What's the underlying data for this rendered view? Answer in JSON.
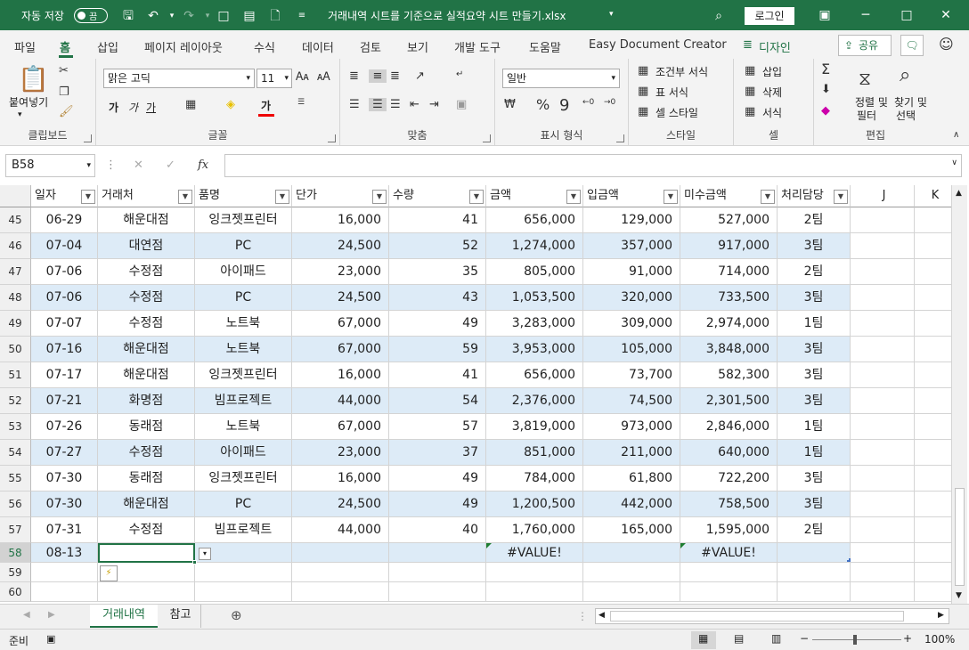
{
  "title": {
    "autosave_label": "자동 저장",
    "toggle_state": "끔",
    "filename": "거래내역 시트를 기준으로 실적요약 시트 만들기.xlsx",
    "login": "로그인"
  },
  "tabs": [
    "파일",
    "홈",
    "삽입",
    "페이지 레이아웃",
    "수식",
    "데이터",
    "검토",
    "보기",
    "개발 도구",
    "도움말",
    "Easy Document Creator",
    "디자인"
  ],
  "share": "공유",
  "ribbon": {
    "clipboard": {
      "paste": "붙여넣기",
      "name": "클립보드"
    },
    "font": {
      "family": "맑은 고딕",
      "size": "11",
      "name": "글꼴",
      "bold": "가",
      "italic": "가",
      "underline": "가",
      "font_color": "가"
    },
    "align": {
      "name": "맞춤"
    },
    "number": {
      "format": "일반",
      "name": "표시 형식"
    },
    "styles": {
      "conditional": "조건부 서식",
      "table": "표 서식",
      "cell": "셀 스타일",
      "name": "스타일"
    },
    "cells": {
      "insert": "삽입",
      "delete": "삭제",
      "format": "서식",
      "name": "셀"
    },
    "editing": {
      "sort": "정렬 및",
      "filter": "필터",
      "find": "찾기 및",
      "select": "선택",
      "name": "편집"
    }
  },
  "formula": {
    "namebox": "B58",
    "fx": "fx",
    "value": ""
  },
  "columns": [
    "일자",
    "거래처",
    "품명",
    "단가",
    "수량",
    "금액",
    "입금액",
    "미수금액",
    "처리담당",
    "J",
    "K"
  ],
  "rows": [
    {
      "n": "45",
      "d": [
        "06-29",
        "해운대점",
        "잉크젯프린터",
        "16,000",
        "41",
        "656,000",
        "129,000",
        "527,000",
        "2팀"
      ]
    },
    {
      "n": "46",
      "d": [
        "07-04",
        "대연점",
        "PC",
        "24,500",
        "52",
        "1,274,000",
        "357,000",
        "917,000",
        "3팀"
      ]
    },
    {
      "n": "47",
      "d": [
        "07-06",
        "수정점",
        "아이패드",
        "23,000",
        "35",
        "805,000",
        "91,000",
        "714,000",
        "2팀"
      ]
    },
    {
      "n": "48",
      "d": [
        "07-06",
        "수정점",
        "PC",
        "24,500",
        "43",
        "1,053,500",
        "320,000",
        "733,500",
        "3팀"
      ]
    },
    {
      "n": "49",
      "d": [
        "07-07",
        "수정점",
        "노트북",
        "67,000",
        "49",
        "3,283,000",
        "309,000",
        "2,974,000",
        "1팀"
      ]
    },
    {
      "n": "50",
      "d": [
        "07-16",
        "해운대점",
        "노트북",
        "67,000",
        "59",
        "3,953,000",
        "105,000",
        "3,848,000",
        "3팀"
      ]
    },
    {
      "n": "51",
      "d": [
        "07-17",
        "해운대점",
        "잉크젯프린터",
        "16,000",
        "41",
        "656,000",
        "73,700",
        "582,300",
        "3팀"
      ]
    },
    {
      "n": "52",
      "d": [
        "07-21",
        "화명점",
        "빔프로젝트",
        "44,000",
        "54",
        "2,376,000",
        "74,500",
        "2,301,500",
        "3팀"
      ]
    },
    {
      "n": "53",
      "d": [
        "07-26",
        "동래점",
        "노트북",
        "67,000",
        "57",
        "3,819,000",
        "973,000",
        "2,846,000",
        "1팀"
      ]
    },
    {
      "n": "54",
      "d": [
        "07-27",
        "수정점",
        "아이패드",
        "23,000",
        "37",
        "851,000",
        "211,000",
        "640,000",
        "1팀"
      ]
    },
    {
      "n": "55",
      "d": [
        "07-30",
        "동래점",
        "잉크젯프린터",
        "16,000",
        "49",
        "784,000",
        "61,800",
        "722,200",
        "3팀"
      ]
    },
    {
      "n": "56",
      "d": [
        "07-30",
        "해운대점",
        "PC",
        "24,500",
        "49",
        "1,200,500",
        "442,000",
        "758,500",
        "3팀"
      ]
    },
    {
      "n": "57",
      "d": [
        "07-31",
        "수정점",
        "빔프로젝트",
        "44,000",
        "40",
        "1,760,000",
        "165,000",
        "1,595,000",
        "2팀"
      ]
    },
    {
      "n": "58",
      "d": [
        "08-13",
        "",
        "",
        "",
        "",
        "#VALUE!",
        "",
        "#VALUE!",
        ""
      ]
    },
    {
      "n": "59",
      "d": [
        "",
        "",
        "",
        "",
        "",
        "",
        "",
        "",
        ""
      ]
    },
    {
      "n": "60",
      "d": [
        "",
        "",
        "",
        "",
        "",
        "",
        "",
        "",
        ""
      ]
    }
  ],
  "sheets": [
    "거래내역",
    "참고"
  ],
  "status": {
    "ready": "준비",
    "zoom": "100%"
  }
}
